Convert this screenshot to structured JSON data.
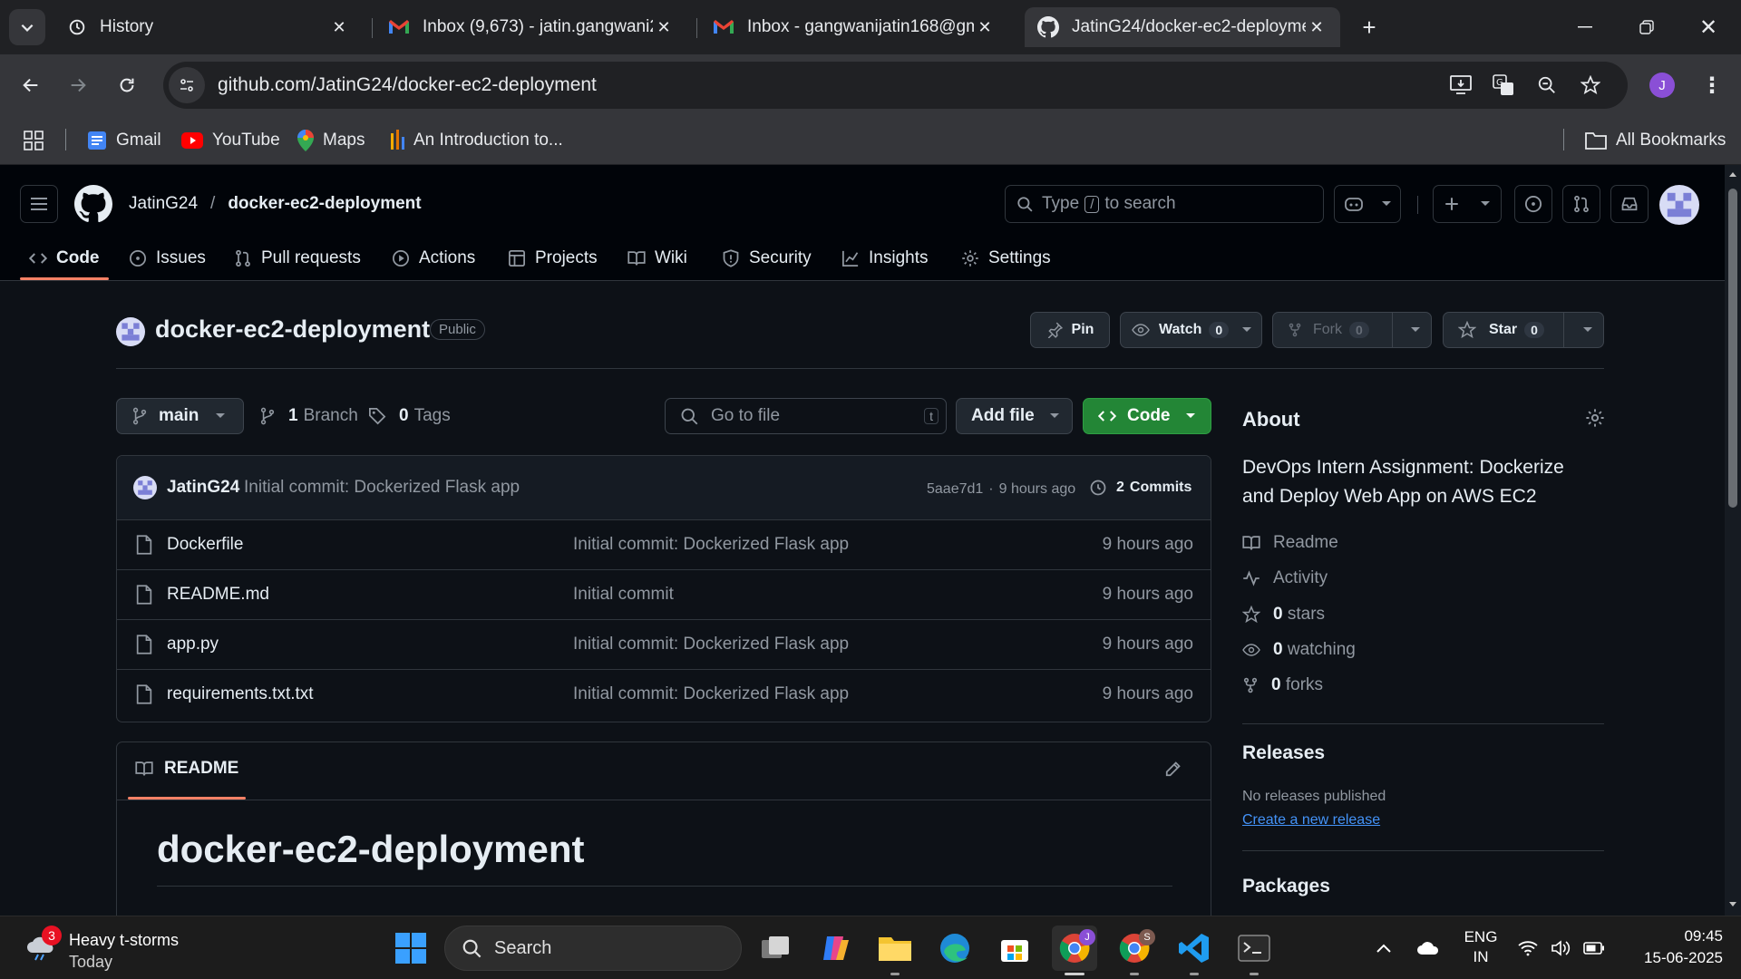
{
  "browser": {
    "tabs": [
      {
        "title": "History",
        "icon": "history-icon"
      },
      {
        "title": "Inbox (9,673) - jatin.gangwani2",
        "icon": "gmail-icon"
      },
      {
        "title": "Inbox - gangwanijatin168@gma",
        "icon": "gmail-icon"
      },
      {
        "title": "JatinG24/docker-ec2-deployme",
        "icon": "github-icon"
      }
    ],
    "url": "github.com/JatinG24/docker-ec2-deployment",
    "profile_initial": "J",
    "bookmarks": [
      {
        "label": "Gmail"
      },
      {
        "label": "YouTube"
      },
      {
        "label": "Maps"
      },
      {
        "label": "An Introduction to..."
      }
    ],
    "all_bookmarks": "All Bookmarks"
  },
  "github": {
    "owner": "JatinG24",
    "separator": "/",
    "repo": "docker-ec2-deployment",
    "search_prefix": "Type",
    "search_key": "/",
    "search_suffix": "to search",
    "nav": [
      {
        "label": "Code",
        "icon": "code-icon"
      },
      {
        "label": "Issues",
        "icon": "issue-icon"
      },
      {
        "label": "Pull requests",
        "icon": "pull-request-icon"
      },
      {
        "label": "Actions",
        "icon": "play-icon"
      },
      {
        "label": "Projects",
        "icon": "table-icon"
      },
      {
        "label": "Wiki",
        "icon": "book-icon"
      },
      {
        "label": "Security",
        "icon": "shield-icon"
      },
      {
        "label": "Insights",
        "icon": "graph-icon"
      },
      {
        "label": "Settings",
        "icon": "gear-icon"
      }
    ],
    "repo_title": "docker-ec2-deployment",
    "visibility": "Public",
    "pin": "Pin",
    "watch": {
      "label": "Watch",
      "count": "0"
    },
    "fork": {
      "label": "Fork",
      "count": "0"
    },
    "star": {
      "label": "Star",
      "count": "0"
    },
    "branch": "main",
    "branches_count": "1",
    "branches_label": "Branch",
    "tags_count": "0",
    "tags_label": "Tags",
    "goto_placeholder": "Go to file",
    "goto_key": "t",
    "add_file": "Add file",
    "code_button": "Code",
    "commit": {
      "author": "JatinG24",
      "message": "Initial commit: Dockerized Flask app",
      "hash": "5aae7d1",
      "dot": "·",
      "time": "9 hours ago",
      "commits_count": "2",
      "commits_label": "Commits"
    },
    "files": [
      {
        "name": "Dockerfile",
        "message": "Initial commit: Dockerized Flask app",
        "time": "9 hours ago"
      },
      {
        "name": "README.md",
        "message": "Initial commit",
        "time": "9 hours ago"
      },
      {
        "name": "app.py",
        "message": "Initial commit: Dockerized Flask app",
        "time": "9 hours ago"
      },
      {
        "name": "requirements.txt.txt",
        "message": "Initial commit: Dockerized Flask app",
        "time": "9 hours ago"
      }
    ],
    "readme_tab": "README",
    "readme_heading": "docker-ec2-deployment",
    "about": {
      "title": "About",
      "description_line1": "DevOps Intern Assignment: Dockerize",
      "description_line2": "and Deploy Web App on AWS EC2",
      "readme": "Readme",
      "activity": "Activity",
      "stars_count": "0",
      "stars_label": "stars",
      "watching_count": "0",
      "watching_label": "watching",
      "forks_count": "0",
      "forks_label": "forks"
    },
    "releases": {
      "title": "Releases",
      "none": "No releases published",
      "create": "Create a new release"
    },
    "packages": {
      "title": "Packages"
    }
  },
  "taskbar": {
    "weather_badge": "3",
    "weather_title": "Heavy t-storms",
    "weather_sub": "Today",
    "search": "Search",
    "lang1": "ENG",
    "lang2": "IN",
    "time": "09:45",
    "date": "15-06-2025",
    "chrome_badge1": "J",
    "chrome_badge2": "S"
  },
  "colors": {
    "accent_green": "#238636",
    "link_blue": "#4493f8",
    "nav_underline": "#f78166"
  }
}
